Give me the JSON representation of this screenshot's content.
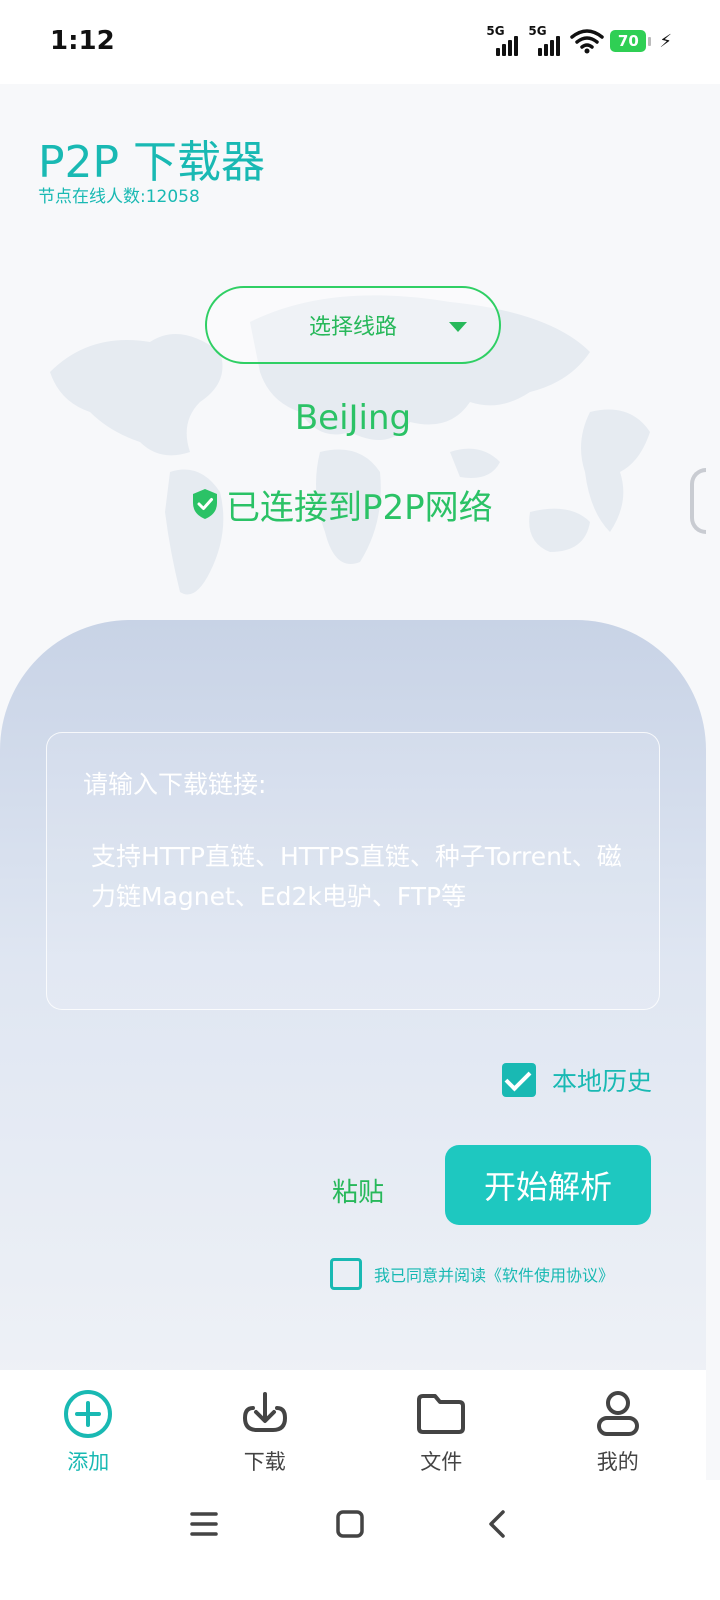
{
  "status_bar": {
    "time": "1:12",
    "signal1_label": "5G",
    "signal2_label": "5G",
    "battery": "70",
    "wifi_icon": "wifi-icon",
    "bolt": "⚡"
  },
  "header": {
    "title": "P2P 下载器",
    "online_count": "节点在线人数:12058"
  },
  "connection": {
    "route_label": "选择线路",
    "city": "BeiJing",
    "status": "已连接到P2P网络",
    "status_color": "#2bc266"
  },
  "input": {
    "placeholder_line1": "请输入下载链接:",
    "placeholder_line2": "支持HTTP直链、HTTPS直链、种子Torrent、磁力链Magnet、Ed2k电驴、FTP等"
  },
  "options": {
    "history_label": "本地历史",
    "history_checked": true,
    "agree_label": "我已同意并阅读《软件使用协议》",
    "agree_checked": false
  },
  "actions": {
    "paste": "粘贴",
    "start": "开始解析"
  },
  "tabs": [
    {
      "label": "添加",
      "icon": "plus-circle-icon",
      "active": true
    },
    {
      "label": "下载",
      "icon": "download-icon",
      "active": false
    },
    {
      "label": "文件",
      "icon": "folder-icon",
      "active": false
    },
    {
      "label": "我的",
      "icon": "user-icon",
      "active": false
    }
  ],
  "colors": {
    "accent": "#19b9b3",
    "green": "#2bc266",
    "button": "#1ec8c0"
  }
}
